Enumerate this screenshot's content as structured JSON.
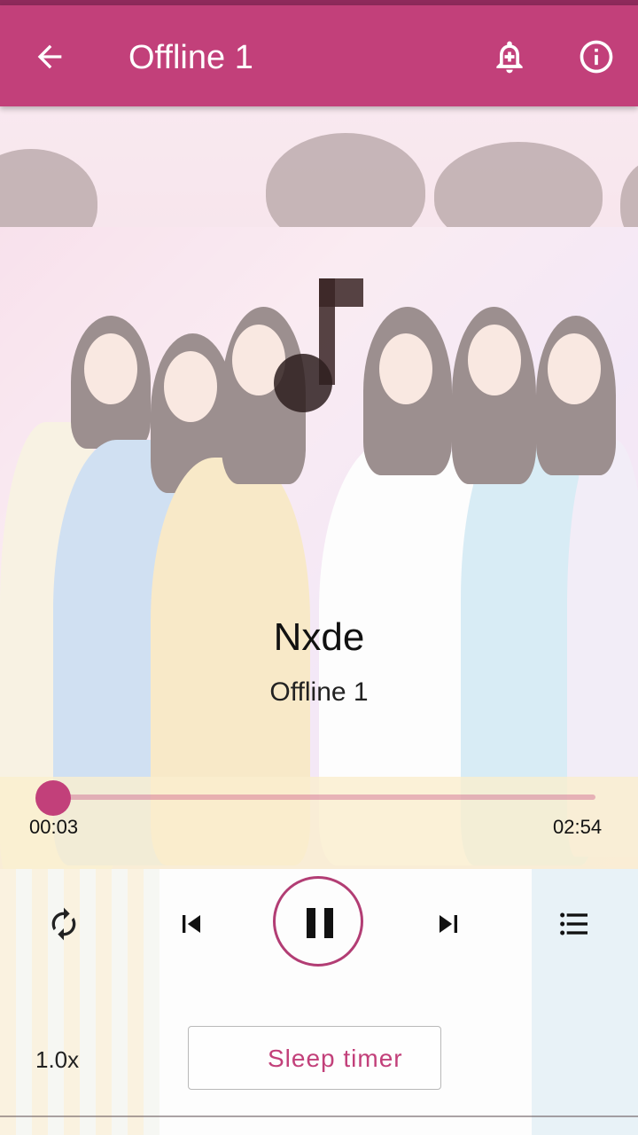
{
  "appbar": {
    "title": "Offline 1",
    "icons": {
      "back": "arrow-back-icon",
      "alarm": "alarm-add-icon",
      "info": "info-icon"
    },
    "color": "#c2407a"
  },
  "artwork": {
    "placeholder_icon": "music-note-icon"
  },
  "track": {
    "title": "Nxde",
    "playlist": "Offline 1"
  },
  "progress": {
    "current": "00:03",
    "duration": "02:54",
    "fraction": 0.017
  },
  "controls": {
    "repeat_icon": "repeat-icon",
    "previous_icon": "skip-previous-icon",
    "play_pause_icon": "pause-icon",
    "next_icon": "skip-next-icon",
    "queue_icon": "queue-list-icon"
  },
  "footer": {
    "speed": "1.0x",
    "sleep_timer_label": "Sleep timer",
    "sleep_icon": "moon-icon"
  },
  "colors": {
    "accent": "#c2407a",
    "text": "#111111"
  }
}
